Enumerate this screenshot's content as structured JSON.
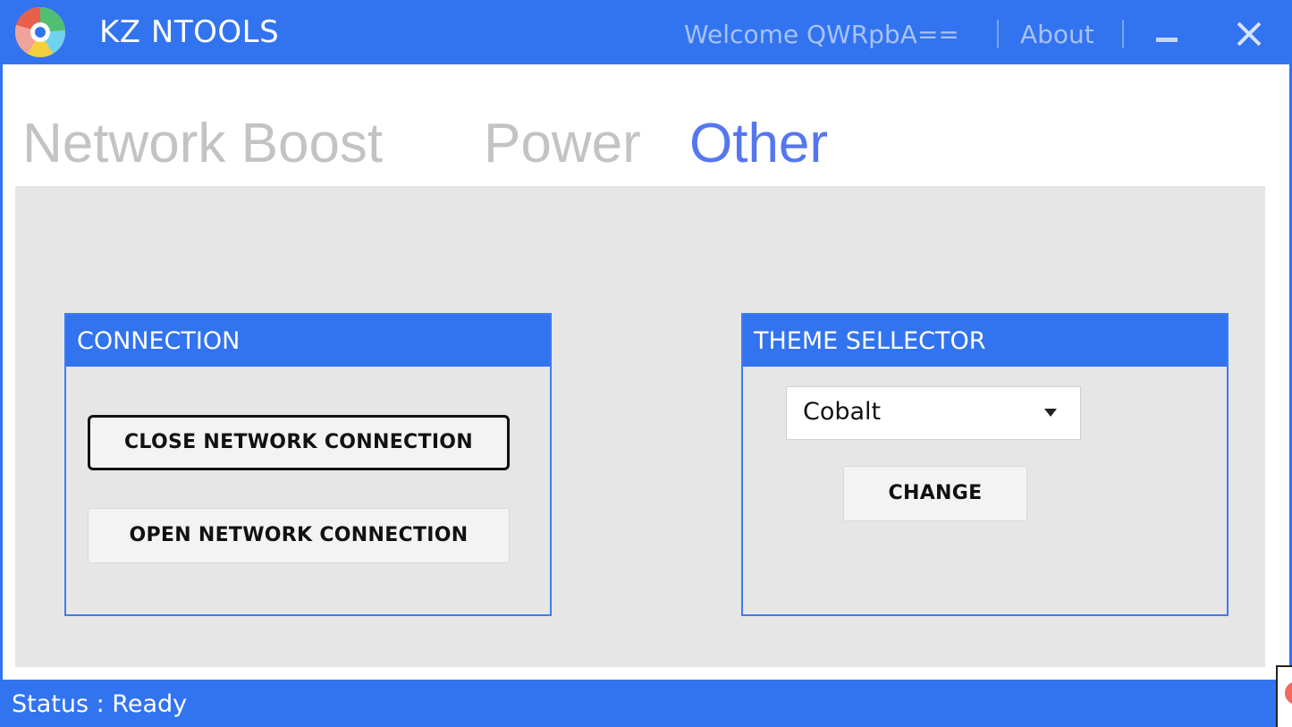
{
  "app": {
    "title": "KZ NTOOLS",
    "logo_icon": "kz-ntools-logo",
    "welcome_text": "Welcome QWRpbA==",
    "about_label": "About",
    "minimize_icon": "minimize-icon",
    "close_icon": "close-icon"
  },
  "tabs": [
    {
      "label": "Network Boost",
      "active": false
    },
    {
      "label": "Power",
      "active": false
    },
    {
      "label": "Other",
      "active": true
    }
  ],
  "connection_panel": {
    "title": "CONNECTION",
    "close_button_label": "CLOSE NETWORK CONNECTION",
    "open_button_label": "OPEN NETWORK CONNECTION"
  },
  "theme_panel": {
    "title": "THEME SELLECTOR",
    "selected_theme": "Cobalt",
    "change_button_label": "CHANGE"
  },
  "status": {
    "text": "Status : Ready"
  },
  "colors": {
    "accent": "#3273f0",
    "active_tab": "#5577ee",
    "inactive_tab": "#c3c3c3",
    "content_bg": "#e6e6e6"
  }
}
